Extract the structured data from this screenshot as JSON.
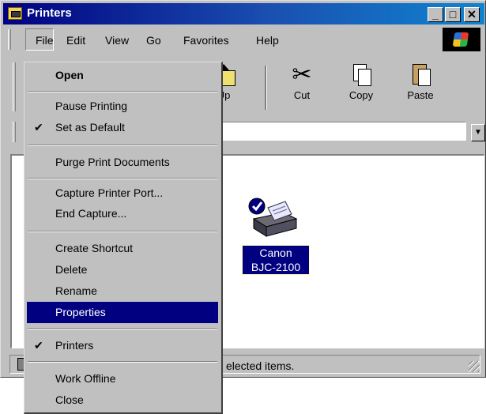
{
  "window": {
    "title": "Printers"
  },
  "menubar": {
    "items": [
      "File",
      "Edit",
      "View",
      "Go",
      "Favorites",
      "Help"
    ]
  },
  "toolbar": {
    "up": "Up",
    "cut": "Cut",
    "copy": "Copy",
    "paste": "Paste"
  },
  "printer": {
    "name_line1": "Canon",
    "name_line2": "BJC-2100"
  },
  "status": {
    "text": "elected items."
  },
  "file_menu": {
    "open": "Open",
    "pause_printing": "Pause Printing",
    "set_default": "Set as Default",
    "purge": "Purge Print Documents",
    "capture_port": "Capture Printer Port...",
    "end_capture": "End Capture...",
    "create_shortcut": "Create Shortcut",
    "delete": "Delete",
    "rename": "Rename",
    "properties": "Properties",
    "printers": "Printers",
    "work_offline": "Work Offline",
    "close": "Close"
  },
  "colors": {
    "highlight": "#000080",
    "face": "#c0c0c0",
    "title_gradient_end": "#1084d0"
  }
}
